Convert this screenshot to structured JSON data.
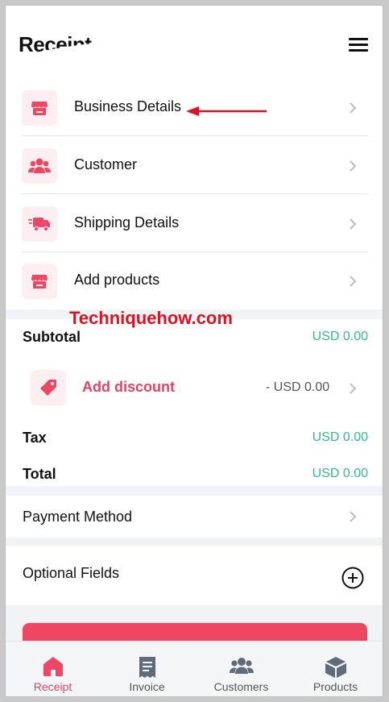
{
  "header": {
    "title": "Receipt"
  },
  "rows": [
    {
      "label": "Business Details",
      "icon": "store-icon"
    },
    {
      "label": "Customer",
      "icon": "customer-group-icon"
    },
    {
      "label": "Shipping Details",
      "icon": "delivery-truck-icon"
    },
    {
      "label": "Add products",
      "icon": "store-icon"
    }
  ],
  "watermark": "Techniquehow.com",
  "totals": {
    "subtotal_label": "Subtotal",
    "subtotal_value": "USD 0.00",
    "discount_label": "Add discount",
    "discount_value": "- USD 0.00",
    "tax_label": "Tax",
    "tax_value": "USD 0.00",
    "total_label": "Total",
    "total_value": "USD 0.00"
  },
  "payment_method": {
    "label": "Payment Method"
  },
  "optional_fields": {
    "label": "Optional Fields"
  },
  "tabs": [
    {
      "label": "Receipt",
      "icon": "home-icon",
      "active": true
    },
    {
      "label": "Invoice",
      "icon": "invoice-icon",
      "active": false
    },
    {
      "label": "Customers",
      "icon": "customers-icon",
      "active": false
    },
    {
      "label": "Products",
      "icon": "box-icon",
      "active": false
    }
  ],
  "colors": {
    "accent": "#ef4664",
    "accent_text": "#e2435f",
    "money_green": "#2ebd8a",
    "icon_bg": "#fdeff1",
    "annotation_red": "#e0101f"
  }
}
